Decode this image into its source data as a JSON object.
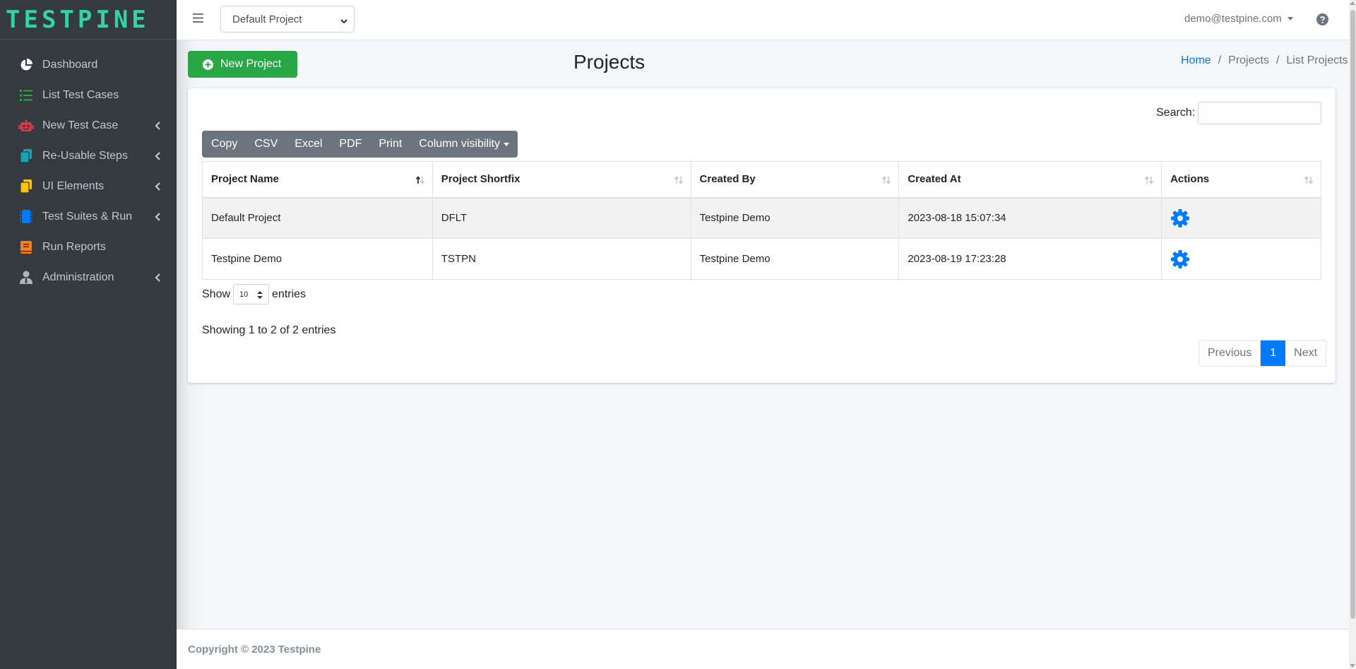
{
  "brand": {
    "name": "TESTPINE",
    "color": "#34d3a5"
  },
  "sidebar": {
    "items": [
      {
        "label": "Dashboard",
        "icon": "pie-chart-icon",
        "color": "#ffffff",
        "has_submenu": false
      },
      {
        "label": "List Test Cases",
        "icon": "list-icon",
        "color": "#28a745",
        "has_submenu": false
      },
      {
        "label": "New Test Case",
        "icon": "robot-icon",
        "color": "#dc3545",
        "has_submenu": true
      },
      {
        "label": "Re-Usable Steps",
        "icon": "copy-icon",
        "color": "#17a2b8",
        "has_submenu": true
      },
      {
        "label": "UI Elements",
        "icon": "files-icon",
        "color": "#ffc107",
        "has_submenu": true
      },
      {
        "label": "Test Suites & Run",
        "icon": "microchip-icon",
        "color": "#007bff",
        "has_submenu": true
      },
      {
        "label": "Run Reports",
        "icon": "book-icon",
        "color": "#fd7e14",
        "has_submenu": false
      },
      {
        "label": "Administration",
        "icon": "user-tie-icon",
        "color": "#adb5bd",
        "has_submenu": true
      }
    ]
  },
  "navbar": {
    "project_select": "Default Project",
    "user_email": "demo@testpine.com"
  },
  "header": {
    "new_project_label": "New Project",
    "title": "Projects",
    "breadcrumb": [
      "Home",
      "Projects",
      "List Projects"
    ]
  },
  "table_tools": {
    "search_label": "Search:",
    "search_value": "",
    "buttons": [
      "Copy",
      "CSV",
      "Excel",
      "PDF",
      "Print",
      "Column visibility"
    ]
  },
  "table": {
    "columns": [
      "Project Name",
      "Project Shortfix",
      "Created By",
      "Created At",
      "Actions"
    ],
    "rows": [
      {
        "name": "Default Project",
        "shortfix": "DFLT",
        "created_by": "Testpine Demo",
        "created_at": "2023-08-18 15:07:34",
        "action_icon": "gear-icon"
      },
      {
        "name": "Testpine Demo",
        "shortfix": "TSTPN",
        "created_by": "Testpine Demo",
        "created_at": "2023-08-19 17:23:28",
        "action_icon": "gear-icon"
      }
    ]
  },
  "length": {
    "show": "Show",
    "value": "10",
    "entries": "entries"
  },
  "info": "Showing 1 to 2 of 2 entries",
  "pagination": {
    "previous": "Previous",
    "current": "1",
    "next": "Next"
  },
  "footer": {
    "text": "Copyright © 2023 Testpine"
  },
  "colors": {
    "primary": "#007bff",
    "success": "#28a745",
    "sidebar_bg": "#343a40",
    "secondary": "#6c757d"
  }
}
